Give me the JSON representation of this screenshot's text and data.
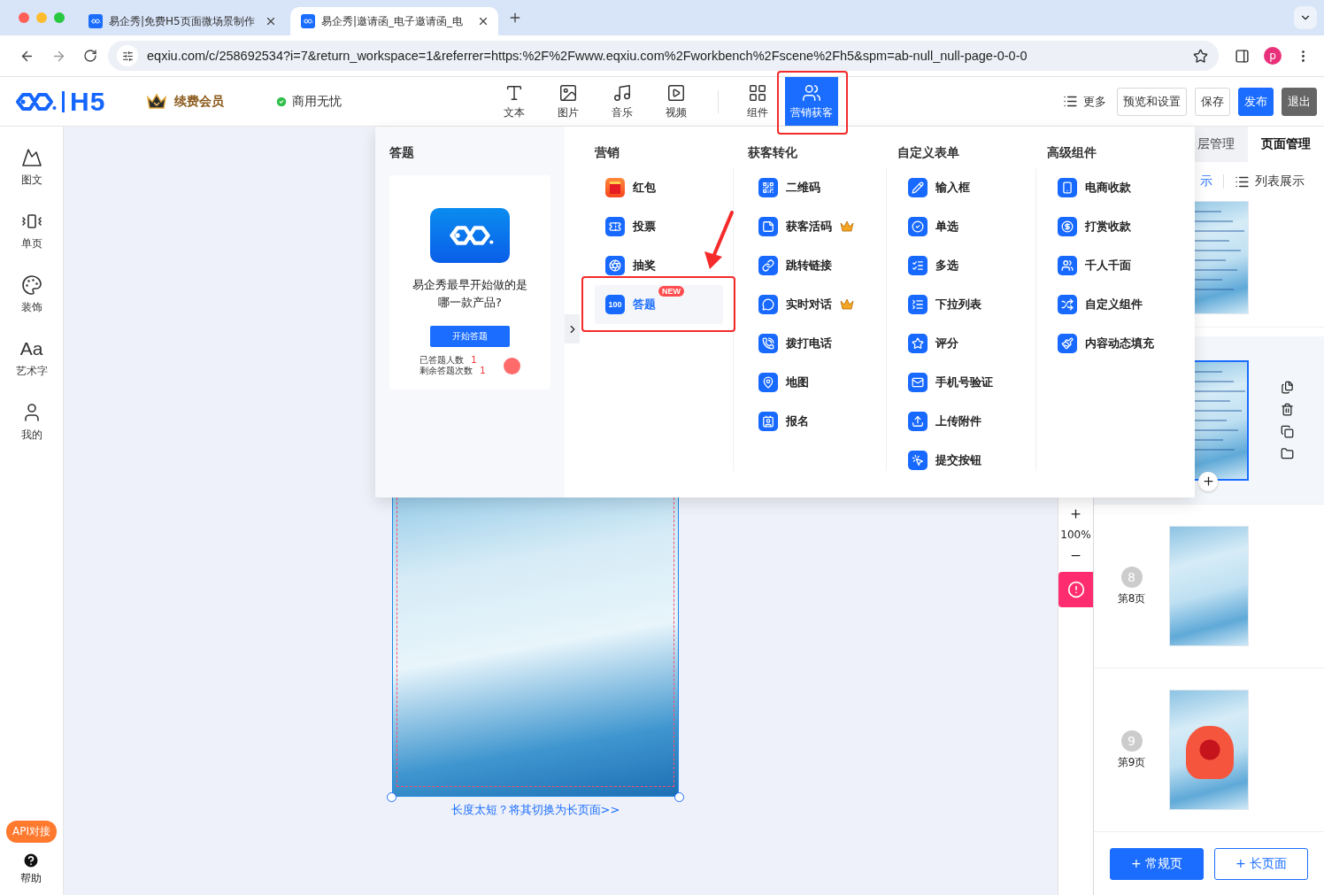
{
  "browser": {
    "tabs": [
      {
        "title": "易企秀|免费H5页面微场景制作",
        "selected": false
      },
      {
        "title": "易企秀|邀请函_电子邀请函_电",
        "selected": true
      }
    ],
    "url": "eqxiu.com/c/258692534?i=7&return_workspace=1&referrer=https:%2F%2Fwww.eqxiu.com%2Fworkbench%2Fscene%2Fh5&spm=ab-null_null-page-0-0-0",
    "profile": "p"
  },
  "header": {
    "logo_text": "H5",
    "member": "续费会员",
    "commercial": "商用无忧",
    "tool_groups": [
      {
        "items": [
          {
            "label": "文本",
            "selected": false
          },
          {
            "label": "图片",
            "selected": false
          },
          {
            "label": "音乐",
            "selected": false
          },
          {
            "label": "视频",
            "selected": false
          }
        ]
      },
      {
        "items": [
          {
            "label": "组件",
            "selected": false
          },
          {
            "label": "营销获客",
            "selected": true
          }
        ]
      }
    ],
    "more": "更多",
    "actions": [
      {
        "label": "预览和设置",
        "kind": "outline"
      },
      {
        "label": "保存",
        "kind": "outline"
      },
      {
        "label": "发布",
        "kind": "primary"
      },
      {
        "label": "退出",
        "kind": "dark"
      }
    ]
  },
  "sidebar": {
    "items": [
      {
        "label": "图文"
      },
      {
        "label": "单页"
      },
      {
        "label": "装饰"
      },
      {
        "label": "艺术字",
        "icon_text": "Aa"
      },
      {
        "label": "我的"
      }
    ],
    "api": "API对接",
    "help": "帮助"
  },
  "canvas": {
    "hint_link": "长度太短？将其切换为长页面>>"
  },
  "zoom": {
    "level": "100%"
  },
  "right_panel": {
    "tabs": [
      {
        "label": "层管理",
        "selected": false
      },
      {
        "label": "页面管理",
        "selected": true
      }
    ],
    "view_modes": [
      {
        "label": "示",
        "selected": true
      },
      {
        "label": "列表展示",
        "selected": false
      }
    ],
    "pages": [
      {
        "kind": "text",
        "selected": false
      },
      {
        "kind": "text",
        "selected": true
      },
      {
        "kind": "plain",
        "number": "8",
        "label": "第8页",
        "selected": false
      },
      {
        "kind": "gift",
        "number": "9",
        "label": "第9页",
        "selected": false
      }
    ],
    "add_buttons": [
      {
        "label": "+ 常规页",
        "kind": "primary"
      },
      {
        "label": "+ 长页面",
        "kind": "outline"
      }
    ]
  },
  "dropdown": {
    "preview": {
      "title": "答题",
      "question": "易企秀最早开始做的是哪一款产品?",
      "start_button": "开始答题",
      "stats": [
        {
          "label": "已答题人数",
          "value": "1"
        },
        {
          "label": "剩余答题次数",
          "value": "1"
        }
      ]
    },
    "groups": [
      {
        "title": "营销",
        "items": [
          {
            "label": "红包",
            "selected": false,
            "vip": false
          },
          {
            "label": "投票",
            "selected": false,
            "vip": false
          },
          {
            "label": "抽奖",
            "selected": false,
            "vip": false
          },
          {
            "label": "答题",
            "selected": true,
            "vip": false,
            "badge": "NEW",
            "icon_text": "100"
          }
        ]
      },
      {
        "title": "获客转化",
        "items": [
          {
            "label": "二维码",
            "selected": false,
            "vip": false
          },
          {
            "label": "获客活码",
            "selected": false,
            "vip": true
          },
          {
            "label": "跳转链接",
            "selected": false,
            "vip": false
          },
          {
            "label": "实时对话",
            "selected": false,
            "vip": true
          },
          {
            "label": "拨打电话",
            "selected": false,
            "vip": false
          },
          {
            "label": "地图",
            "selected": false,
            "vip": false
          },
          {
            "label": "报名",
            "selected": false,
            "vip": false
          }
        ]
      },
      {
        "title": "自定义表单",
        "items": [
          {
            "label": "输入框",
            "selected": false,
            "vip": false
          },
          {
            "label": "单选",
            "selected": false,
            "vip": false
          },
          {
            "label": "多选",
            "selected": false,
            "vip": false
          },
          {
            "label": "下拉列表",
            "selected": false,
            "vip": false
          },
          {
            "label": "评分",
            "selected": false,
            "vip": false
          },
          {
            "label": "手机号验证",
            "selected": false,
            "vip": false
          },
          {
            "label": "上传附件",
            "selected": false,
            "vip": false
          },
          {
            "label": "提交按钮",
            "selected": false,
            "vip": false
          }
        ]
      },
      {
        "title": "高级组件",
        "items": [
          {
            "label": "电商收款",
            "selected": false,
            "vip": false
          },
          {
            "label": "打赏收款",
            "selected": false,
            "vip": false
          },
          {
            "label": "千人千面",
            "selected": false,
            "vip": false
          },
          {
            "label": "自定义组件",
            "selected": false,
            "vip": false
          },
          {
            "label": "内容动态填充",
            "selected": false,
            "vip": false
          }
        ]
      }
    ]
  }
}
